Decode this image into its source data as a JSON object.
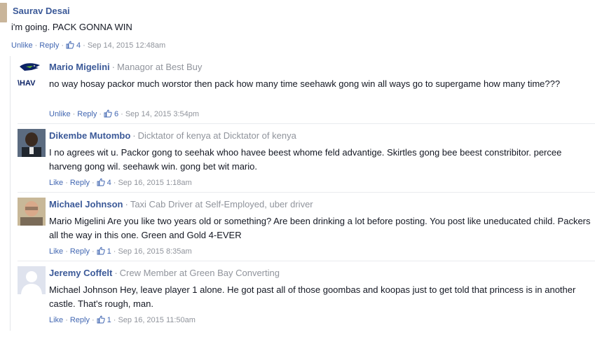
{
  "top_comment": {
    "author": "Saurav Desai",
    "text": "i'm going. PACK GONNA WIN",
    "actions": {
      "like": "Unlike",
      "reply": "Reply",
      "likes": "4",
      "date": "Sep 14, 2015 12:48am"
    }
  },
  "replies": [
    {
      "author": "Mario Migelini",
      "role": "Managor at Best Buy",
      "text": "no way hosay packor much worstor then pack how many time seehawk gong win all ways go to supergame how many time???",
      "avatar_text": "\\HAV",
      "actions": {
        "like": "Unlike",
        "reply": "Reply",
        "likes": "6",
        "date": "Sep 14, 2015 3:54pm"
      }
    },
    {
      "author": "Dikembe Mutombo",
      "role": "Dicktator of kenya at Dicktator of kenya",
      "text": "I no agrees wit u. Packor gong to seehak whoo havee beest whome feld advantige. Skirtles gong bee beest constribitor. percee harveng gong wil. seehawk win. gong bet wit mario.",
      "actions": {
        "like": "Like",
        "reply": "Reply",
        "likes": "4",
        "date": "Sep 16, 2015 1:18am"
      }
    },
    {
      "author": "Michael Johnson",
      "role": "Taxi Cab Driver at Self-Employed, uber driver",
      "text": "Mario Migelini Are you like two years old or something? Are been drinking a lot before posting. You post like uneducated child. Packers all the way in this one. Green and Gold 4-EVER",
      "actions": {
        "like": "Like",
        "reply": "Reply",
        "likes": "1",
        "date": "Sep 16, 2015 8:35am"
      }
    },
    {
      "author": "Jeremy Coffelt",
      "role": "Crew Member at Green Bay Converting",
      "text": "Michael Johnson Hey, leave player 1 alone. He got past all of those goombas and koopas just to get told that princess is in another castle. That's rough, man.",
      "actions": {
        "like": "Like",
        "reply": "Reply",
        "likes": "1",
        "date": "Sep 16, 2015 11:50am"
      }
    }
  ],
  "colors": {
    "name": "#3b5998",
    "link": "#4267b2",
    "meta": "#90949c",
    "text": "#141823"
  }
}
